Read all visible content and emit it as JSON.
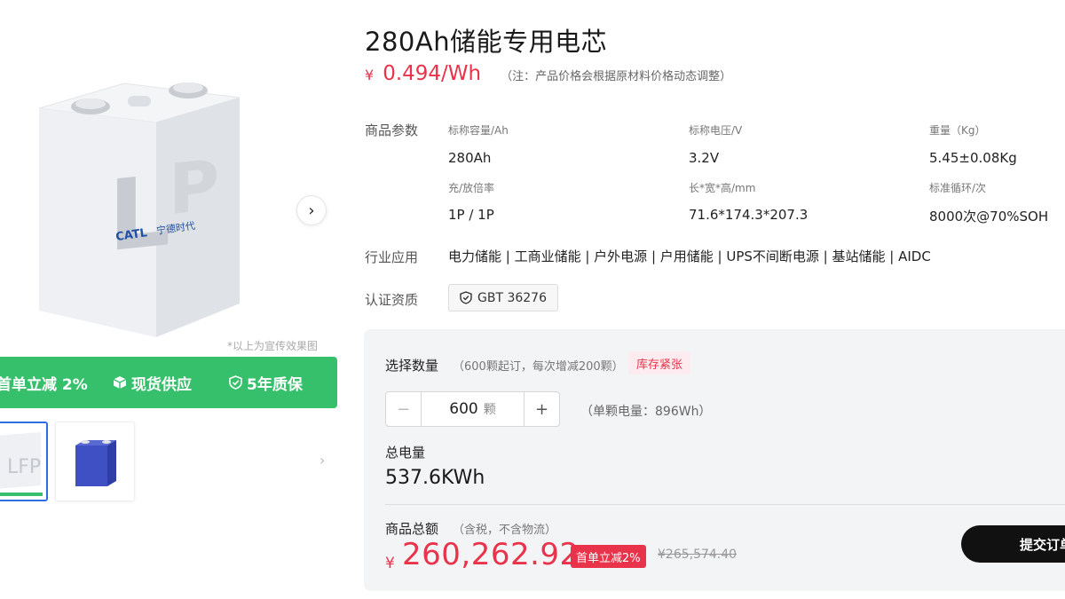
{
  "product": {
    "title": "280Ah储能专用电芯",
    "price_currency": "¥",
    "price": "0.494/Wh",
    "price_note": "（注：产品价格会根据原材料价格动态调整）"
  },
  "gallery": {
    "image_note": "*以上为宣传效果图",
    "cell_brand": "CATL",
    "cell_brand_cn": "宁德时代",
    "cell_mark": "LFP",
    "benefits": [
      {
        "icon": "tag-icon",
        "label": "首单立减 2%"
      },
      {
        "icon": "cube-icon",
        "label": "现货供应"
      },
      {
        "icon": "shield-icon",
        "label": "5年质保"
      }
    ]
  },
  "params": {
    "section_label": "商品参数",
    "items": [
      {
        "label": "标称容量/Ah",
        "value": "280Ah"
      },
      {
        "label": "标称电压/V",
        "value": "3.2V"
      },
      {
        "label": "重量（Kg）",
        "value": "5.45±0.08Kg"
      },
      {
        "label": "充/放倍率",
        "value": "1P / 1P"
      },
      {
        "label": "长*宽*高/mm",
        "value": "71.6*174.3*207.3"
      },
      {
        "label": "标准循环/次",
        "value": "8000次@70%SOH"
      }
    ]
  },
  "applications": {
    "section_label": "行业应用",
    "text": "电力储能 | 工商业储能 | 户外电源 | 户用储能 | UPS不间断电源 | 基站储能 | AIDC"
  },
  "certification": {
    "section_label": "认证资质",
    "badge": "GBT 36276"
  },
  "purchase": {
    "qty_label": "选择数量",
    "qty_hint": "（600颗起订，每次增减200颗）",
    "stock_badge": "库存紧张",
    "stepper_minus": "−",
    "stepper_plus": "+",
    "quantity": "600",
    "quantity_unit": "颗",
    "single_power": "（单颗电量：896Wh）",
    "total_energy_label": "总电量",
    "total_energy": "537.6KWh",
    "total_label": "商品总额",
    "total_hint": "（含税，不含物流）",
    "total_currency": "¥",
    "total_price": "260,262.92",
    "discount_badge": "首单立减2%",
    "original_price": "¥265,574.40",
    "submit_label": "提交订单"
  },
  "colors": {
    "price_red": "#e8334a",
    "promo_green": "#37c06c",
    "panel_bg": "#f3f4f6",
    "submit_bg": "#111111",
    "thumb_selected_border": "#2d6fe0"
  }
}
